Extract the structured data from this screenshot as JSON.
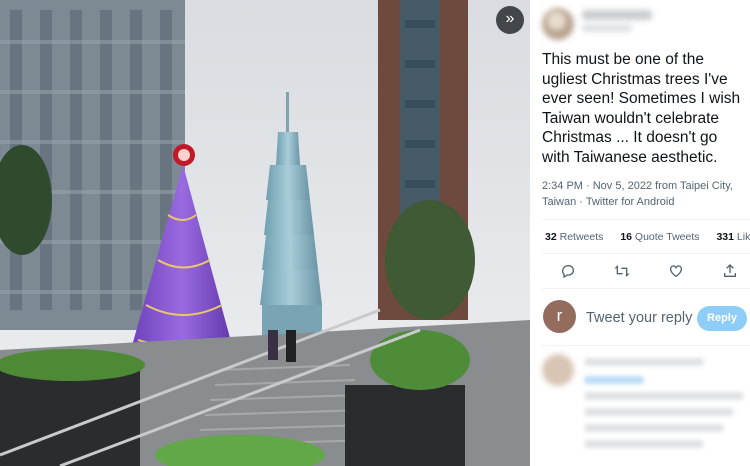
{
  "viewer": {
    "expand_icon": "double-chevron-right-icon",
    "expand_glyph": "»"
  },
  "tweet": {
    "text": "This must be one of the ugliest Christmas trees I've ever seen! Sometimes I wish Taiwan wouldn't celebrate Christmas ... It doesn't go with Taiwanese aesthetic.",
    "meta": "2:34 PM · Nov 5, 2022 from Taipei City, Taiwan · Twitter for Android",
    "retweets_count": "32",
    "retweets_label": "Retweets",
    "quotes_count": "16",
    "quotes_label": "Quote Tweets",
    "likes_count": "331",
    "likes_label": "Likes"
  },
  "actions": {
    "reply_icon": "reply-icon",
    "retweet_icon": "retweet-icon",
    "like_icon": "heart-icon",
    "share_icon": "share-icon"
  },
  "reply": {
    "avatar_letter": "r",
    "placeholder": "Tweet your reply",
    "button_label": "Reply"
  },
  "colors": {
    "accent": "#1d9bf0",
    "reply_button": "#8ecdf8",
    "avatar": "#946c5e",
    "tree": "#7b4fc4"
  }
}
